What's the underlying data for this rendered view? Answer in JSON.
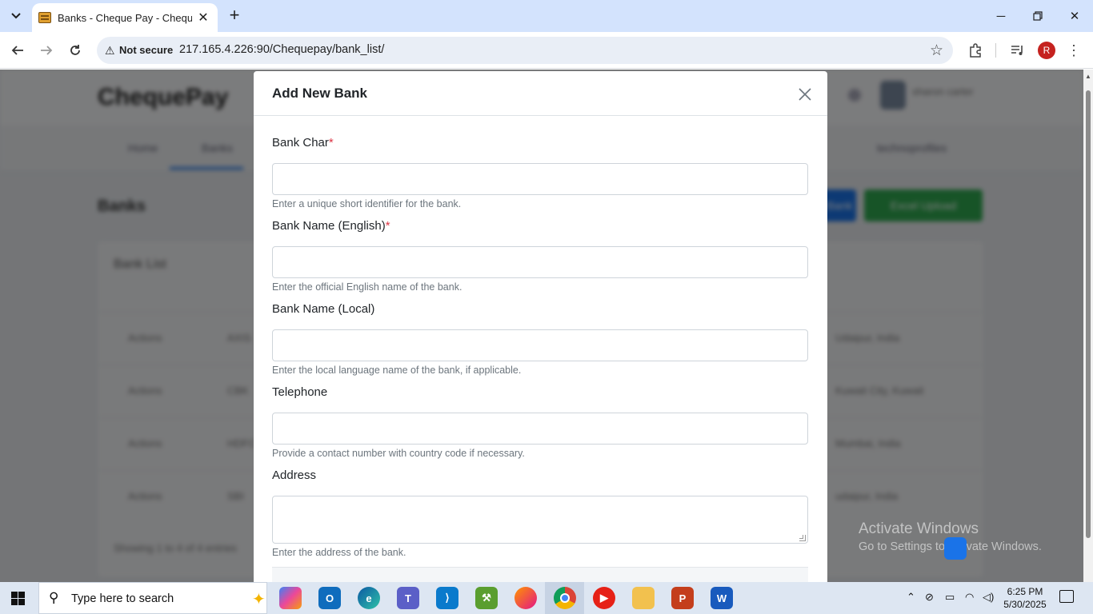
{
  "browser": {
    "tab_title": "Banks - Cheque Pay - Cheque F",
    "not_secure_label": "Not secure",
    "url": "217.165.4.226:90/Chequepay/bank_list/",
    "profile_initial": "R"
  },
  "background_page": {
    "logo": "ChequePay",
    "nav": [
      "Home",
      "Banks",
      "technoprofiles"
    ],
    "title": "Banks",
    "buttons": [
      "Add Bank",
      "Excel Upload"
    ],
    "card_title": "Bank List",
    "rows": [
      {
        "action": "Actions",
        "code": "AXIS",
        "address": "Udaipur, India"
      },
      {
        "action": "Actions",
        "code": "CBK",
        "address": "Kuwait City, Kuwait"
      },
      {
        "action": "Actions",
        "code": "HDFC",
        "address": "Mumbai, India"
      },
      {
        "action": "Actions",
        "code": "SBI",
        "address": "udaipur, India"
      }
    ],
    "footer_text": "Showing 1 to 4 of 4 entries",
    "user_name": "sharon carter",
    "user_role": "Superadmin"
  },
  "modal": {
    "title": "Add New Bank",
    "fields": [
      {
        "label": "Bank Char",
        "required": "*",
        "help": "Enter a unique short identifier for the bank.",
        "value": ""
      },
      {
        "label": "Bank Name (English)",
        "required": "*",
        "help": "Enter the official English name of the bank.",
        "value": ""
      },
      {
        "label": "Bank Name (Local)",
        "required": "",
        "help": "Enter the local language name of the bank, if applicable.",
        "value": ""
      },
      {
        "label": "Telephone",
        "required": "",
        "help": "Provide a contact number with country code if necessary.",
        "value": ""
      },
      {
        "label": "Address",
        "required": "",
        "help": "Enter the address of the bank.",
        "value": ""
      }
    ]
  },
  "watermark": {
    "line1": "Activate Windows",
    "line2": "Go to Settings to activate Windows."
  },
  "taskbar": {
    "search_placeholder": "Type here to search",
    "time": "6:25 PM",
    "date": "5/30/2025"
  }
}
